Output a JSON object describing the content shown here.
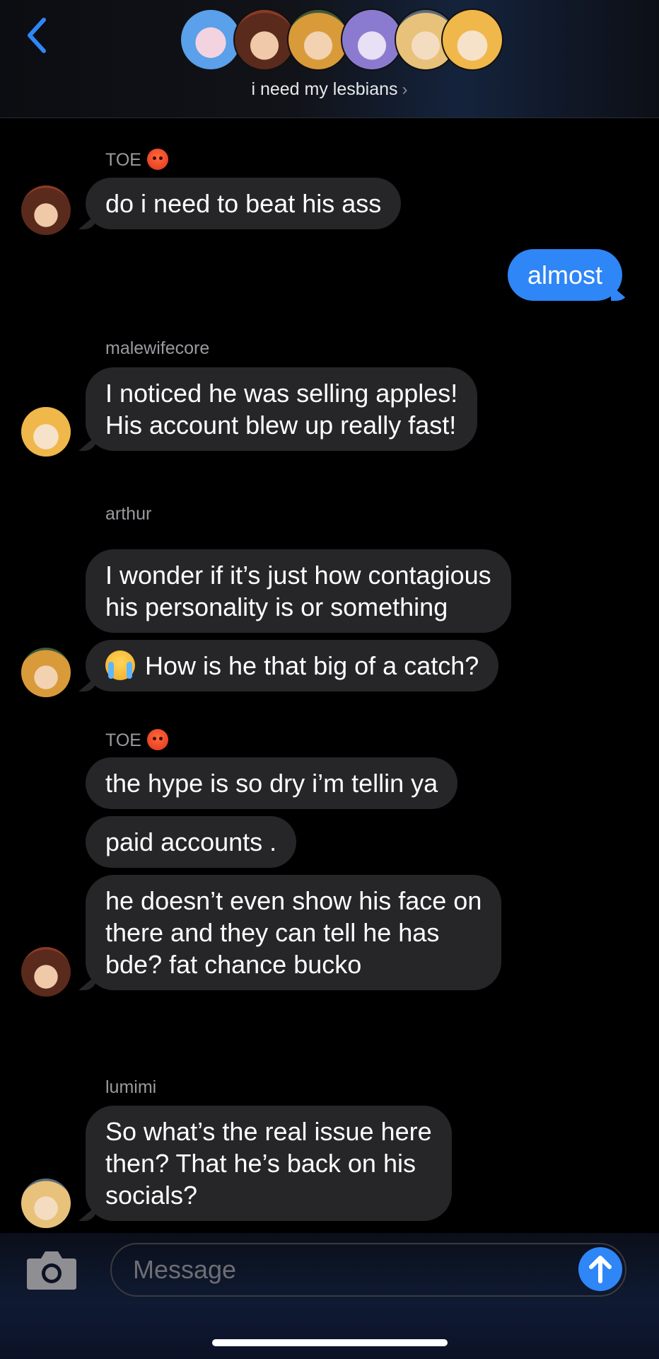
{
  "header": {
    "title": "i need my lesbians",
    "chevron": "›",
    "back_icon": "chevron-left-icon",
    "accent": "#2f86f6"
  },
  "messages": [
    {
      "sender": "TOE",
      "sender_emoji": "angry-face",
      "text": "do i need to beat his ass"
    },
    {
      "from_me": true,
      "text": "almost"
    },
    {
      "sender": "malewifecore",
      "lines": [
        "I noticed he was selling apples!",
        "His account blew up really fast!"
      ]
    },
    {
      "sender": "arthur",
      "lines": [
        "I wonder if it’s just how contagious",
        "his personality is or something"
      ]
    },
    {
      "text": "How is he that big of a catch?",
      "emoji": "loudly-crying-face"
    },
    {
      "sender": "TOE",
      "sender_emoji": "angry-face",
      "text": "the hype is so dry i’m tellin ya"
    },
    {
      "text": "paid accounts ."
    },
    {
      "lines": [
        "he doesn’t even show his face on",
        "there and they can tell he has",
        "bde? fat chance bucko"
      ]
    },
    {
      "sender": "lumimi",
      "lines": [
        "So what’s the real issue here",
        "then? That he’s back on his",
        "socials?"
      ]
    }
  ],
  "composer": {
    "placeholder": "Message",
    "camera_icon": "camera-icon",
    "send_icon": "arrow-up-icon"
  }
}
